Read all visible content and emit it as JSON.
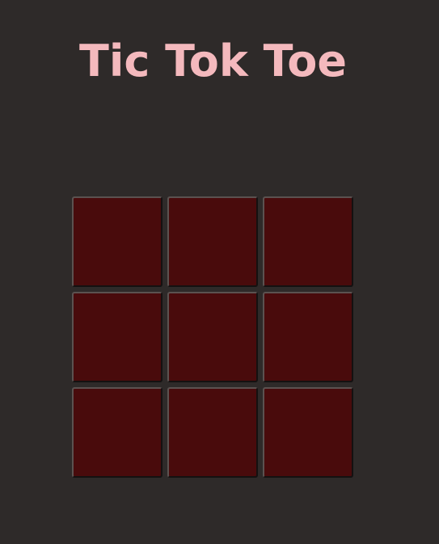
{
  "title": "Tic Tok Toe",
  "colors": {
    "background": "#2e2a29",
    "title": "#f4b9bd",
    "cell": "#490b0c"
  },
  "board": {
    "cells": [
      "",
      "",
      "",
      "",
      "",
      "",
      "",
      "",
      ""
    ]
  }
}
